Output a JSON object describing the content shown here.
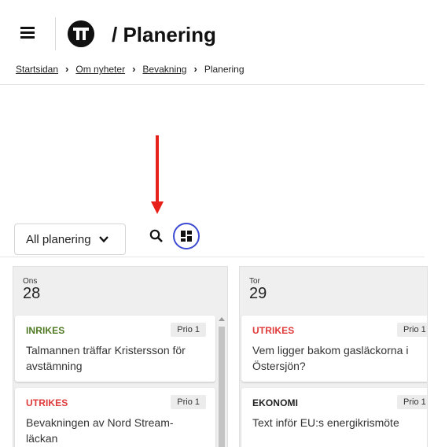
{
  "header": {
    "title": "/ Planering"
  },
  "breadcrumb": {
    "items": [
      "Startsidan",
      "Om nyheter",
      "Bevakning"
    ],
    "current": "Planering",
    "separator": "›"
  },
  "toolbar": {
    "filter_selected": "All planering"
  },
  "columns": [
    {
      "day": "Ons",
      "date": "28",
      "cards": [
        {
          "category": "INRIKES",
          "category_color": "#4f7a22",
          "priority": "Prio 1",
          "headline": "Talmannen träffar Kristersson för avstämning"
        },
        {
          "category": "UTRIKES",
          "category_color": "#e03a3a",
          "priority": "Prio 1",
          "headline": "Bevakningen av Nord Stream-läckan"
        }
      ]
    },
    {
      "day": "Tor",
      "date": "29",
      "cards": [
        {
          "category": "UTRIKES",
          "category_color": "#e03a3a",
          "priority": "Prio 1",
          "headline": "Vem ligger bakom gasläckorna i Östersjön?"
        },
        {
          "category": "EKONOMI",
          "category_color": "#1f1f1f",
          "priority": "Prio 1",
          "headline": "Text inför EU:s energikrismöte"
        }
      ]
    }
  ],
  "colors": {
    "accent": "#3c4ad1",
    "arrow": "#e8201a"
  }
}
